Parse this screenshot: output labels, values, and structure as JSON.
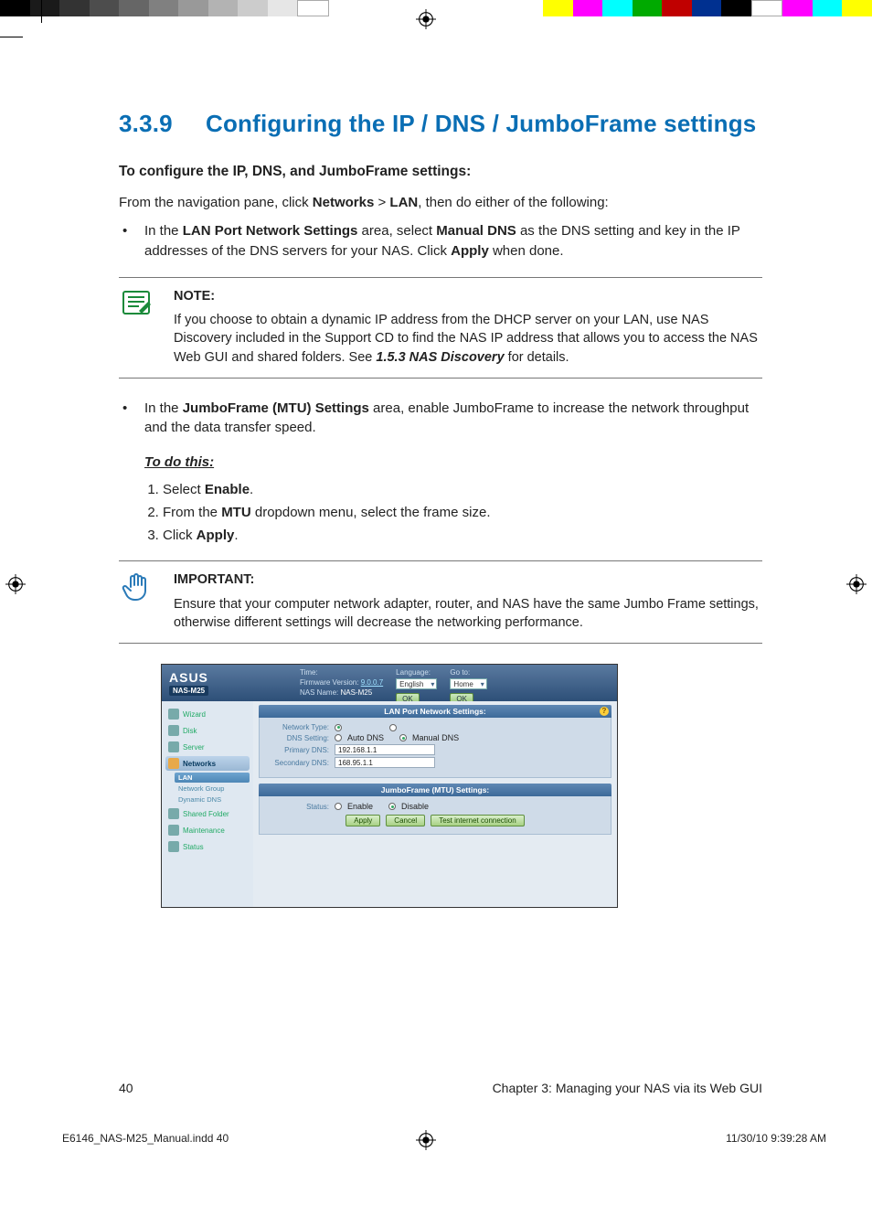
{
  "section_number": "3.3.9",
  "section_title": "Configuring the IP / DNS / JumboFrame settings",
  "lead": "To configure the IP, DNS, and JumboFrame settings:",
  "intro_prefix": "From the navigation pane, click ",
  "intro_b1": "Networks",
  "intro_mid": " > ",
  "intro_b2": "LAN",
  "intro_suffix": ", then do either of the following:",
  "bul1_a": "In the ",
  "bul1_b1": "LAN Port Network Settings",
  "bul1_b": " area, select ",
  "bul1_b2": "Manual DNS",
  "bul1_c": " as the DNS setting and key in the IP addresses of the DNS servers for your NAS. Click ",
  "bul1_b3": "Apply",
  "bul1_d": " when done.",
  "note_hdr": "NOTE:",
  "note_body_a": "If you choose to obtain a dynamic IP address from the DHCP server on your LAN, use NAS Discovery included in the Support CD to find the NAS IP address that allows you to access the NAS Web GUI and shared folders. See ",
  "note_body_ref": "1.5.3 NAS Discovery",
  "note_body_b": " for details.",
  "bul2_a": "In the ",
  "bul2_b1": "JumboFrame (MTU) Settings",
  "bul2_b": " area, enable JumboFrame to increase the network throughput and the data transfer speed.",
  "todo_hdr": "To do this:",
  "step1_a": "Select ",
  "step1_b": "Enable",
  "step1_c": ".",
  "step2_a": "From the ",
  "step2_b": "MTU",
  "step2_c": " dropdown menu, select the frame size.",
  "step3_a": "Click ",
  "step3_b": "Apply",
  "step3_c": ".",
  "imp_hdr": "IMPORTANT:",
  "imp_body": "Ensure that your computer network adapter, router, and NAS have the same Jumbo Frame settings, otherwise different settings will decrease the networking performance.",
  "shot": {
    "brand": "ASUS",
    "model": "NAS-M25",
    "time_label": "Time:",
    "fw_label": "Firmware Version:",
    "fw_val": "9.0.0.7",
    "nasname_label": "NAS Name:",
    "nasname_val": "NAS-M25",
    "lang_label": "Language:",
    "lang_val": "English",
    "goto_label": "Go to:",
    "goto_val": "Home",
    "ok": "OK",
    "side": {
      "wizard": "Wizard",
      "disk": "Disk",
      "server": "Server",
      "networks": "Networks",
      "lan": "LAN",
      "netgroup": "Network Group",
      "dyndns": "Dynamic DNS",
      "shared": "Shared Folder",
      "maint": "Maintenance",
      "status": "Status"
    },
    "panel1": {
      "title": "LAN Port Network Settings:",
      "nettype": "Network Type:",
      "dnssetting": "DNS Setting:",
      "autodns": "Auto DNS",
      "manualdns": "Manual DNS",
      "pdns": "Primary DNS:",
      "pdns_v": "192.168.1.1",
      "sdns": "Secondary DNS:",
      "sdns_v": "168.95.1.1"
    },
    "panel2": {
      "title": "JumboFrame (MTU) Settings:",
      "status": "Status:",
      "enable": "Enable",
      "disable": "Disable"
    },
    "btns": {
      "apply": "Apply",
      "cancel": "Cancel",
      "test": "Test internet connection"
    }
  },
  "page_num": "40",
  "chapter": "Chapter 3: Managing your NAS via its Web GUI",
  "slug_file": "E6146_NAS-M25_Manual.indd   40",
  "slug_time": "11/30/10   9:39:28 AM"
}
